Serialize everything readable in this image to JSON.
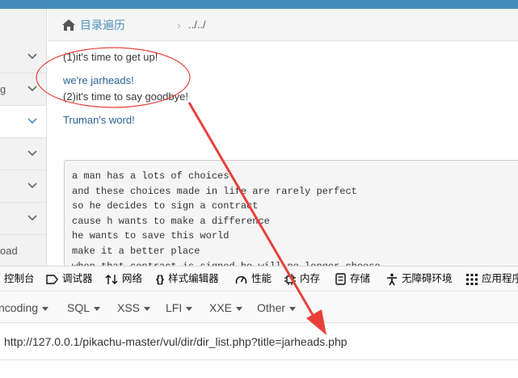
{
  "sidebar": {
    "items": [
      {
        "label": "",
        "active": false
      },
      {
        "label": "g",
        "active": false
      },
      {
        "label": "",
        "active": true
      },
      {
        "label": "",
        "active": false
      },
      {
        "label": "",
        "active": false
      },
      {
        "label": "",
        "active": false
      },
      {
        "label": "oad",
        "active": false
      }
    ]
  },
  "breadcrumbs": {
    "home_icon": "home-icon",
    "section": "目录遍历",
    "separator": "›",
    "current": "../../"
  },
  "content": {
    "line1": "(1)it's time to get up!",
    "link1": "we're jarheads!",
    "line2": "(2)it's time to say goodbye!",
    "link2": "Truman's word!",
    "poem": [
      "a man has a lots of choices",
      "and these choices made in life are rarely perfect",
      "so he decides to sign a contract",
      "cause h wants to make a difference",
      "he wants to save this world",
      "make it a better place",
      "when that contract is signed he will no longer choose"
    ]
  },
  "annotation": {
    "color": "#e8413b"
  },
  "devtools": {
    "tabs": [
      {
        "label": "控制台",
        "icon": "console-icon"
      },
      {
        "label": "调试器",
        "icon": "debugger-icon"
      },
      {
        "label": "网络",
        "icon": "network-icon"
      },
      {
        "label": "样式编辑器",
        "icon": "style-editor-icon"
      },
      {
        "label": "性能",
        "icon": "performance-icon"
      },
      {
        "label": "内存",
        "icon": "memory-icon"
      },
      {
        "label": "存储",
        "icon": "storage-icon"
      },
      {
        "label": "无障碍环境",
        "icon": "accessibility-icon"
      },
      {
        "label": "应用程序",
        "icon": "application-icon"
      }
    ]
  },
  "hackbar": {
    "menus": [
      "ncoding",
      "SQL",
      "XSS",
      "LFI",
      "XXE",
      "Other"
    ]
  },
  "url": {
    "value": "http://127.0.0.1/pikachu-master/vul/dir/dir_list.php?title=jarheads.php"
  }
}
